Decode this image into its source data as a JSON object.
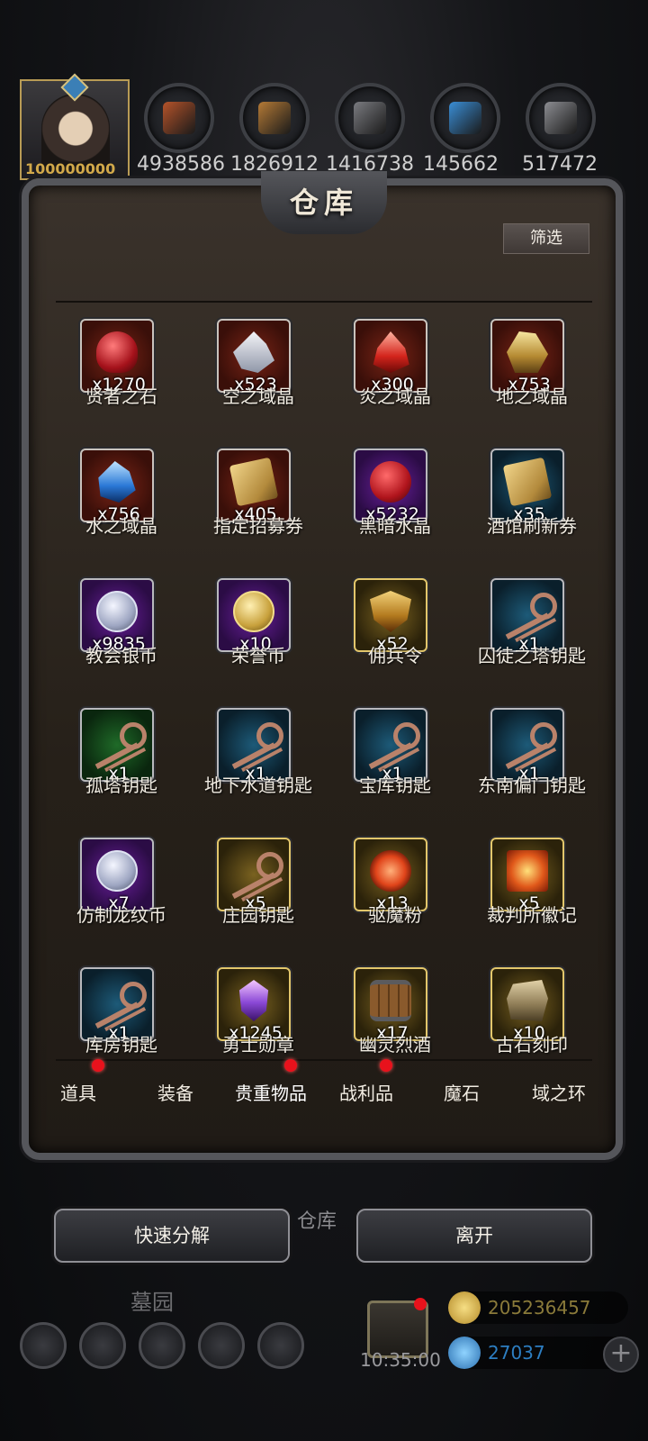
{
  "header": {
    "avatar_value": "100000000",
    "resources": [
      {
        "icon": "meat-icon",
        "color": "#b5532a",
        "value": "4938586"
      },
      {
        "icon": "wood-icon",
        "color": "#b57a36",
        "value": "1826912"
      },
      {
        "icon": "stone-icon",
        "color": "#7a7b80",
        "value": "1416738"
      },
      {
        "icon": "crystal-icon",
        "color": "#3a8ed6",
        "value": "145662"
      },
      {
        "icon": "iron-icon",
        "color": "#8c8d92",
        "value": "517472"
      }
    ]
  },
  "panel": {
    "title": "仓库",
    "filter_label": "筛选"
  },
  "items": [
    {
      "name": "贤者之石",
      "count": "x1270",
      "quality": "red",
      "pic": "stone"
    },
    {
      "name": "空之域晶",
      "count": "x523",
      "quality": "red",
      "pic": "shard"
    },
    {
      "name": "炎之域晶",
      "count": "x300",
      "quality": "red",
      "pic": "fire"
    },
    {
      "name": "地之域晶",
      "count": "x753",
      "quality": "red",
      "pic": "earth"
    },
    {
      "name": "水之域晶",
      "count": "x756",
      "quality": "red",
      "pic": "water"
    },
    {
      "name": "指定招募券",
      "count": "x405",
      "quality": "red",
      "pic": "scroll"
    },
    {
      "name": "黑暗水晶",
      "count": "x5232",
      "quality": "purple",
      "pic": "dark"
    },
    {
      "name": "酒馆刷新券",
      "count": "x35",
      "quality": "blue",
      "pic": "scroll"
    },
    {
      "name": "教会银币",
      "count": "x9835",
      "quality": "purple",
      "pic": "coin"
    },
    {
      "name": "荣誉币",
      "count": "x10",
      "quality": "purple",
      "pic": "gcoin"
    },
    {
      "name": "佣兵令",
      "count": "x52",
      "quality": "gold",
      "pic": "shield"
    },
    {
      "name": "囚徒之塔钥匙",
      "count": "x1",
      "quality": "blue",
      "pic": "key"
    },
    {
      "name": "孤塔钥匙",
      "count": "x1",
      "quality": "green",
      "pic": "key"
    },
    {
      "name": "地下水道钥匙",
      "count": "x1",
      "quality": "blue",
      "pic": "key"
    },
    {
      "name": "宝库钥匙",
      "count": "x1",
      "quality": "blue",
      "pic": "key"
    },
    {
      "name": "东南偏门钥匙",
      "count": "x1",
      "quality": "blue",
      "pic": "key"
    },
    {
      "name": "仿制龙纹币",
      "count": "x7",
      "quality": "purple",
      "pic": "coin"
    },
    {
      "name": "庄园钥匙",
      "count": "x5",
      "quality": "gold",
      "pic": "key"
    },
    {
      "name": "驱魔粉",
      "count": "x13",
      "quality": "gold",
      "pic": "powder"
    },
    {
      "name": "裁判所徽记",
      "count": "x5",
      "quality": "gold",
      "pic": "badge"
    },
    {
      "name": "库房钥匙",
      "count": "x1",
      "quality": "blue",
      "pic": "key"
    },
    {
      "name": "勇士勋章",
      "count": "x1245",
      "quality": "gold",
      "pic": "gem2"
    },
    {
      "name": "幽灵烈酒",
      "count": "x17",
      "quality": "gold",
      "pic": "barrel"
    },
    {
      "name": "古石刻印",
      "count": "x10",
      "quality": "gold",
      "pic": "rock"
    }
  ],
  "tabs": [
    {
      "label": "道具",
      "dot": true
    },
    {
      "label": "装备",
      "dot": false
    },
    {
      "label": "贵重物品",
      "dot": true,
      "active": true
    },
    {
      "label": "战利品",
      "dot": true
    },
    {
      "label": "魔石",
      "dot": false
    },
    {
      "label": "域之环",
      "dot": false
    }
  ],
  "actions": {
    "quick_decompose": "快速分解",
    "leave": "离开",
    "behind_label": "仓库"
  },
  "hud": {
    "location": "墓园",
    "time": "10:35:00",
    "gold": "205236457",
    "gems": "27037",
    "plus": "+"
  }
}
